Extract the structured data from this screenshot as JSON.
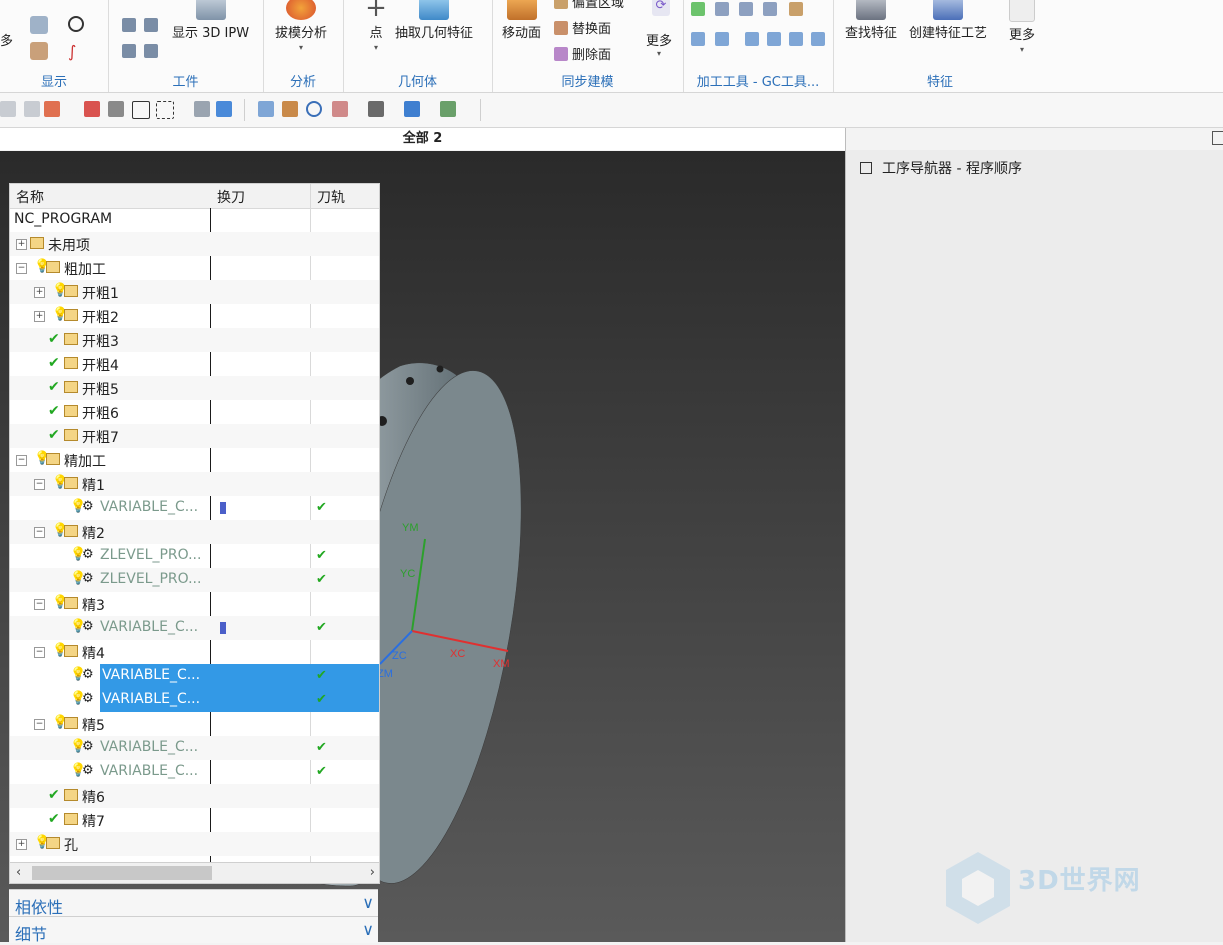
{
  "ribbon": {
    "groups": [
      {
        "label": "显示"
      },
      {
        "label": "工件"
      },
      {
        "label": "分析"
      },
      {
        "label": "几何体"
      },
      {
        "label": "同步建模"
      },
      {
        "label": "加工工具 - GC工具..."
      },
      {
        "label": "特征"
      }
    ],
    "buttons": {
      "more_left": "多",
      "show_ipw": "显示 3D IPW",
      "draft_analysis": "拔模分析",
      "point": "点",
      "extract_geometry": "抽取几何特征",
      "move_face": "移动面",
      "offset_region": "偏置区域",
      "replace_face": "替换面",
      "delete_face": "删除面",
      "more_sync": "更多",
      "find_feature": "查找特征",
      "create_process": "创建特征工艺",
      "more_feature": "更多"
    }
  },
  "viewport": {
    "title": "全部 2",
    "axes": {
      "ym": "YM",
      "yc": "YC",
      "zc": "ZC",
      "zm": "ZM",
      "xc": "XC",
      "xm": "XM"
    },
    "colors": {
      "cyan_face": "#00ffff",
      "body": "#b7c6cc"
    }
  },
  "navigator": {
    "title": "工序导航器 - 程序顺序",
    "columns": {
      "name": "名称",
      "tool_change": "换刀",
      "toolpath": "刀轨"
    },
    "rows": [
      {
        "name": "NC_PROGRAM"
      },
      {
        "name": "未用项"
      },
      {
        "name": "粗加工"
      },
      {
        "name": "开粗1"
      },
      {
        "name": "开粗2"
      },
      {
        "name": "开粗3"
      },
      {
        "name": "开粗4"
      },
      {
        "name": "开粗5"
      },
      {
        "name": "开粗6"
      },
      {
        "name": "开粗7"
      },
      {
        "name": "精加工"
      },
      {
        "name": "精1"
      },
      {
        "name": "VARIABLE_C..."
      },
      {
        "name": "精2"
      },
      {
        "name": "ZLEVEL_PRO..."
      },
      {
        "name": "ZLEVEL_PRO..."
      },
      {
        "name": "精3"
      },
      {
        "name": "VARIABLE_C..."
      },
      {
        "name": "精4"
      },
      {
        "name": "VARIABLE_C..."
      },
      {
        "name": "VARIABLE_C..."
      },
      {
        "name": "精5"
      },
      {
        "name": "VARIABLE_C..."
      },
      {
        "name": "VARIABLE_C..."
      },
      {
        "name": "精6"
      },
      {
        "name": "精7"
      },
      {
        "name": "孔"
      }
    ],
    "panels": {
      "dependencies": "相依性",
      "details": "细节"
    },
    "selection_color": "#3399e6"
  },
  "watermark": {
    "text": "3D世界网"
  }
}
